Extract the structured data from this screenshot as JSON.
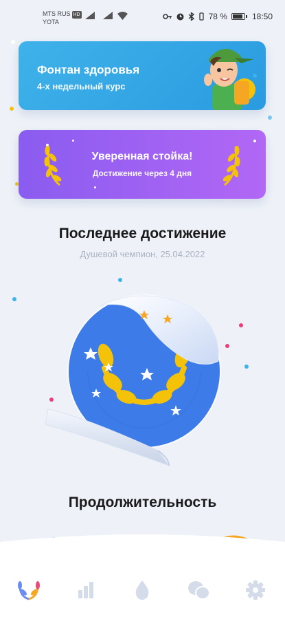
{
  "status_bar": {
    "carrier_line1": "MTS RUS",
    "carrier_badge": "HD",
    "carrier_line2": "YOTA",
    "battery": "78 %",
    "time": "18:50"
  },
  "course_card": {
    "title": "Фонтан здоровья",
    "subtitle": "4-х недельный курс"
  },
  "achievement_card": {
    "title": "Уверенная стойка!",
    "subtitle": "Достижение через 4 дня"
  },
  "latest_achievement": {
    "heading": "Последнее достижение",
    "detail": "Душевой чемпион, 25.04.2022"
  },
  "duration": {
    "heading": "Продолжительность"
  },
  "bottom_nav": [
    {
      "icon": "laurel-icon",
      "active": true
    },
    {
      "icon": "bar-chart-icon",
      "active": false
    },
    {
      "icon": "water-drop-icon",
      "active": false
    },
    {
      "icon": "chat-bubbles-icon",
      "active": false
    },
    {
      "icon": "gear-icon",
      "active": false
    }
  ],
  "colors": {
    "accent_blue": "#3fb2ea",
    "accent_purple": "#8a5cf0",
    "badge_blue": "#3d7be8",
    "gold": "#f5c20a",
    "nav_inactive": "#d4dcea",
    "nav_active": "#6b8cf0"
  }
}
